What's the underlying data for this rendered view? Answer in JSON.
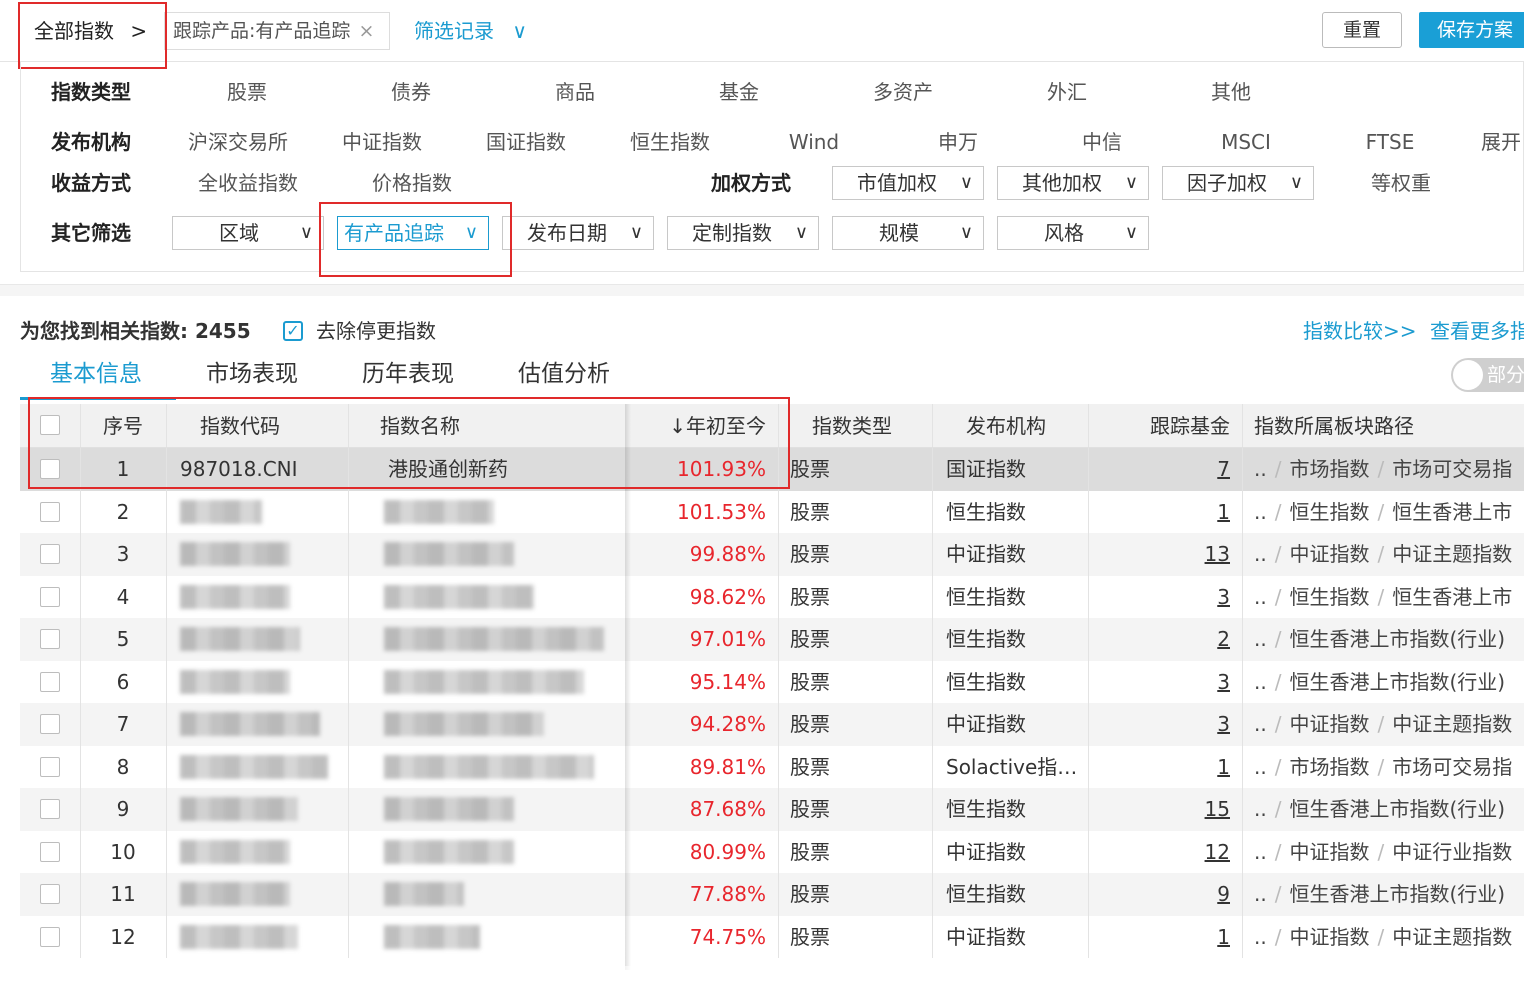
{
  "topbar": {
    "all_indices": "全部指数",
    "all_indices_arrow": ">",
    "tag": "跟踪产品:有产品追踪",
    "tag_close": "×",
    "filter_record": "筛选记录",
    "filter_record_arrow": "∨",
    "reset": "重置",
    "save": "保存方案"
  },
  "filters": {
    "type_label": "指数类型",
    "types": [
      "股票",
      "债券",
      "商品",
      "基金",
      "多资产",
      "外汇",
      "其他"
    ],
    "publisher_label": "发布机构",
    "publishers": [
      "沪深交易所",
      "中证指数",
      "国证指数",
      "恒生指数",
      "Wind",
      "申万",
      "中信",
      "MSCI",
      "FTSE"
    ],
    "expand": "展开",
    "return_label": "收益方式",
    "returns": [
      "全收益指数",
      "价格指数"
    ],
    "weight_label": "加权方式",
    "weights": [
      "市值加权",
      "其他加权",
      "因子加权"
    ],
    "equal_weight": "等权重",
    "other_label": "其它筛选",
    "others": [
      "区域",
      "有产品追踪",
      "发布日期",
      "定制指数",
      "规模",
      "风格"
    ],
    "chevron": "∨"
  },
  "results": {
    "found_text": "为您找到相关指数: 2455",
    "remove_stale": "去除停更指数",
    "remove_stale_check": "✓",
    "compare_link": "指数比较>>",
    "more_link": "查看更多指"
  },
  "tabs": [
    "基本信息",
    "市场表现",
    "历年表现",
    "估值分析"
  ],
  "toggle_label": "部分",
  "table": {
    "headers": {
      "seq": "序号",
      "code": "指数代码",
      "name": "指数名称",
      "ytd": "↓年初至今",
      "type": "指数类型",
      "publisher": "发布机构",
      "funds": "跟踪基金",
      "path": "指数所属板块路径"
    },
    "rows": [
      {
        "seq": "1",
        "code": "987018.CNI",
        "name": "港股通创新药",
        "ytd": "101.93%",
        "type": "股票",
        "publisher": "国证指数",
        "funds": "7",
        "path1": "市场指数",
        "path2": "市场可交易指"
      },
      {
        "seq": "2",
        "code": "",
        "name": "",
        "ytd": "101.53%",
        "type": "股票",
        "publisher": "恒生指数",
        "funds": "1",
        "path1": "恒生指数",
        "path2": "恒生香港上市"
      },
      {
        "seq": "3",
        "code": "",
        "name": "",
        "ytd": "99.88%",
        "type": "股票",
        "publisher": "中证指数",
        "funds": "13",
        "path1": "中证指数",
        "path2": "中证主题指数"
      },
      {
        "seq": "4",
        "code": "",
        "name": "",
        "ytd": "98.62%",
        "type": "股票",
        "publisher": "恒生指数",
        "funds": "3",
        "path1": "恒生指数",
        "path2": "恒生香港上市"
      },
      {
        "seq": "5",
        "code": "",
        "name": "",
        "ytd": "97.01%",
        "type": "股票",
        "publisher": "恒生指数",
        "funds": "2",
        "path1": "恒生香港上市指数(行业)",
        "path2": ""
      },
      {
        "seq": "6",
        "code": "",
        "name": "",
        "ytd": "95.14%",
        "type": "股票",
        "publisher": "恒生指数",
        "funds": "3",
        "path1": "恒生香港上市指数(行业)",
        "path2": ""
      },
      {
        "seq": "7",
        "code": "",
        "name": "",
        "ytd": "94.28%",
        "type": "股票",
        "publisher": "中证指数",
        "funds": "3",
        "path1": "中证指数",
        "path2": "中证主题指数"
      },
      {
        "seq": "8",
        "code": "",
        "name": "",
        "ytd": "89.81%",
        "type": "股票",
        "publisher": "Solactive指…",
        "funds": "1",
        "path1": "市场指数",
        "path2": "市场可交易指"
      },
      {
        "seq": "9",
        "code": "",
        "name": "",
        "ytd": "87.68%",
        "type": "股票",
        "publisher": "恒生指数",
        "funds": "15",
        "path1": "恒生香港上市指数(行业)",
        "path2": ""
      },
      {
        "seq": "10",
        "code": "",
        "name": "",
        "ytd": "80.99%",
        "type": "股票",
        "publisher": "中证指数",
        "funds": "12",
        "path1": "中证指数",
        "path2": "中证行业指数"
      },
      {
        "seq": "11",
        "code": "",
        "name": "",
        "ytd": "77.88%",
        "type": "股票",
        "publisher": "恒生指数",
        "funds": "9",
        "path1": "恒生香港上市指数(行业)",
        "path2": ""
      },
      {
        "seq": "12",
        "code": "",
        "name": "",
        "ytd": "74.75%",
        "type": "股票",
        "publisher": "中证指数",
        "funds": "1",
        "path1": "中证指数",
        "path2": "中证主题指数"
      }
    ],
    "path_prefix": "..",
    "path_sep": "/"
  },
  "colors": {
    "accent": "#1b9bd0",
    "positive": "#e8262d",
    "highlight_box": "#e02a2a"
  }
}
